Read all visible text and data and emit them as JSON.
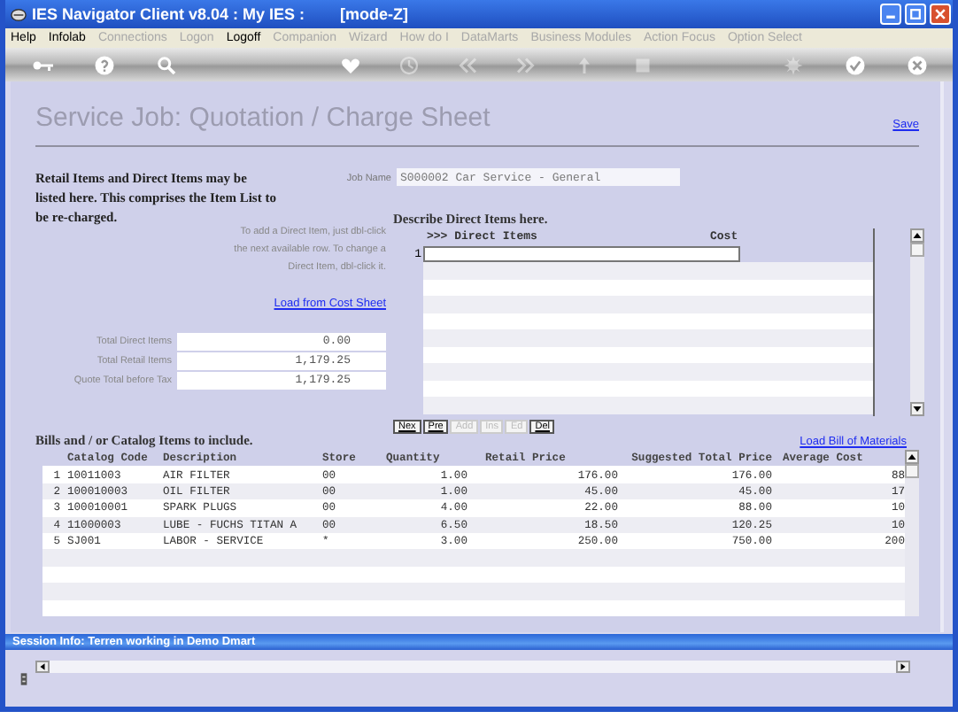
{
  "window": {
    "title": "IES Navigator Client v8.04 : My IES :",
    "mode": "[mode-Z]"
  },
  "menu": [
    {
      "label": "Help",
      "disabled": false
    },
    {
      "label": "Infolab",
      "disabled": false
    },
    {
      "label": "Connections",
      "disabled": true
    },
    {
      "label": "Logon",
      "disabled": true
    },
    {
      "label": "Logoff",
      "disabled": false
    },
    {
      "label": "Companion",
      "disabled": true
    },
    {
      "label": "Wizard",
      "disabled": true
    },
    {
      "label": "How do I",
      "disabled": true
    },
    {
      "label": "DataMarts",
      "disabled": true
    },
    {
      "label": "Business Modules",
      "disabled": true
    },
    {
      "label": "Action Focus",
      "disabled": true
    },
    {
      "label": "Option Select",
      "disabled": true
    }
  ],
  "toolbar": {
    "left": [
      {
        "kind": "key",
        "disabled": false
      },
      {
        "kind": "help",
        "disabled": false
      },
      {
        "kind": "search",
        "disabled": false
      }
    ],
    "center": [
      {
        "kind": "heart",
        "disabled": false
      },
      {
        "kind": "clock",
        "disabled": true
      },
      {
        "kind": "back",
        "disabled": true
      },
      {
        "kind": "forward",
        "disabled": true
      },
      {
        "kind": "up",
        "disabled": true
      },
      {
        "kind": "square",
        "disabled": true
      }
    ],
    "right": [
      {
        "kind": "gear",
        "disabled": true
      },
      {
        "kind": "check",
        "disabled": false
      },
      {
        "kind": "close",
        "disabled": false
      }
    ]
  },
  "page": {
    "title": "Service Job: Quotation / Charge Sheet",
    "save_link": "Save"
  },
  "intro": "Retail Items and Direct Items may be listed here. This comprises the Item List to be re-charged.",
  "job_name": {
    "label": "Job Name",
    "value": "S000002 Car Service - General"
  },
  "hint": "To add a Direct Item, just dbl-click the next available row. To change a Direct Item, dbl-click it.",
  "load_cost_sheet": "Load from Cost Sheet",
  "totals": [
    {
      "label": "Total Direct Items",
      "value": "0.00"
    },
    {
      "label": "Total Retail Items",
      "value": "1,179.25"
    },
    {
      "label": "Quote Total before Tax",
      "value": "1,179.25"
    }
  ],
  "direct_items": {
    "heading": "Describe Direct Items here.",
    "columns": [
      ">>> Direct Items",
      "Cost"
    ],
    "rows": [
      {
        "number": "1"
      }
    ]
  },
  "nav_buttons": [
    {
      "label": "Nex",
      "disabled": false
    },
    {
      "label": "Pre",
      "disabled": false
    },
    {
      "label": "Add",
      "disabled": true
    },
    {
      "label": "Ins",
      "disabled": true
    },
    {
      "label": "Ed",
      "disabled": true
    },
    {
      "label": "Del",
      "disabled": false
    }
  ],
  "catalog": {
    "heading": "Bills and / or Catalog Items to include.",
    "load_link": "Load Bill of Materials",
    "columns": [
      "Catalog Code",
      "Description",
      "Store",
      "Quantity",
      "Retail Price",
      "Suggested Total Price",
      "Average Cost"
    ],
    "rows": [
      {
        "number": "1",
        "cells": [
          "10011003",
          "AIR FILTER",
          "00",
          "1.00",
          "176.00",
          "176.00",
          "88"
        ]
      },
      {
        "number": "2",
        "cells": [
          "100010003",
          "OIL FILTER",
          "00",
          "1.00",
          "45.00",
          "45.00",
          "17"
        ]
      },
      {
        "number": "3",
        "cells": [
          "100010001",
          "SPARK PLUGS",
          "00",
          "4.00",
          "22.00",
          "88.00",
          "10"
        ]
      },
      {
        "number": "4",
        "cells": [
          "11000003",
          "LUBE - FUCHS TITAN A",
          "00",
          "6.50",
          "18.50",
          "120.25",
          "10"
        ]
      },
      {
        "number": "5",
        "cells": [
          "SJ001",
          "LABOR - SERVICE",
          "*",
          "3.00",
          "250.00",
          "750.00",
          "200"
        ]
      }
    ]
  },
  "status_bar": "Session Info: Terren working in Demo Dmart"
}
